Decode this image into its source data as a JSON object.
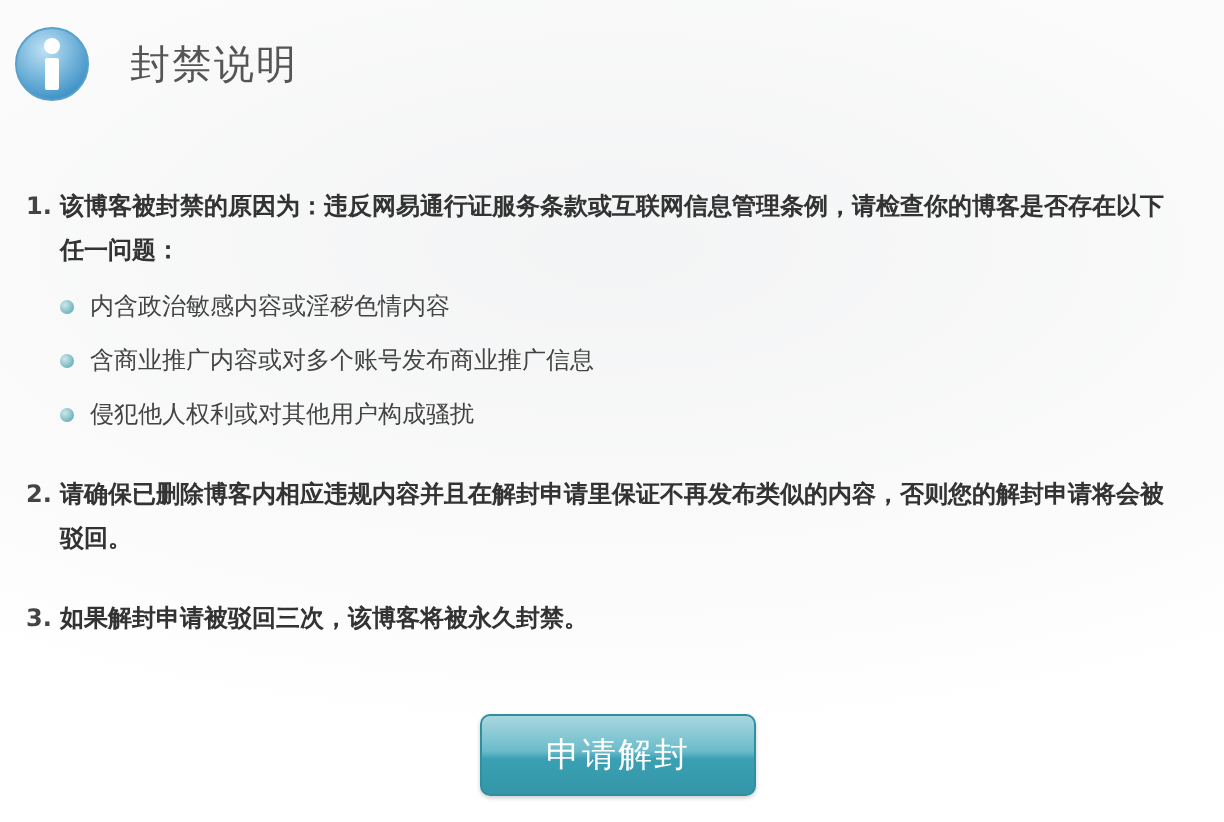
{
  "header": {
    "title": "封禁说明"
  },
  "items": [
    {
      "number": "1.",
      "text": "该博客被封禁的原因为：违反网易通行证服务条款或互联网信息管理条例，请检查你的博客是否存在以下任一问题：",
      "bullets": [
        "内含政治敏感内容或淫秽色情内容",
        "含商业推广内容或对多个账号发布商业推广信息",
        "侵犯他人权利或对其他用户构成骚扰"
      ]
    },
    {
      "number": "2.",
      "text": "请确保已删除博客内相应违规内容并且在解封申请里保证不再发布类似的内容，否则您的解封申请将会被驳回。"
    },
    {
      "number": "3.",
      "text": "如果解封申请被驳回三次，该博客将被永久封禁。"
    }
  ],
  "button": {
    "label": "申请解封"
  }
}
